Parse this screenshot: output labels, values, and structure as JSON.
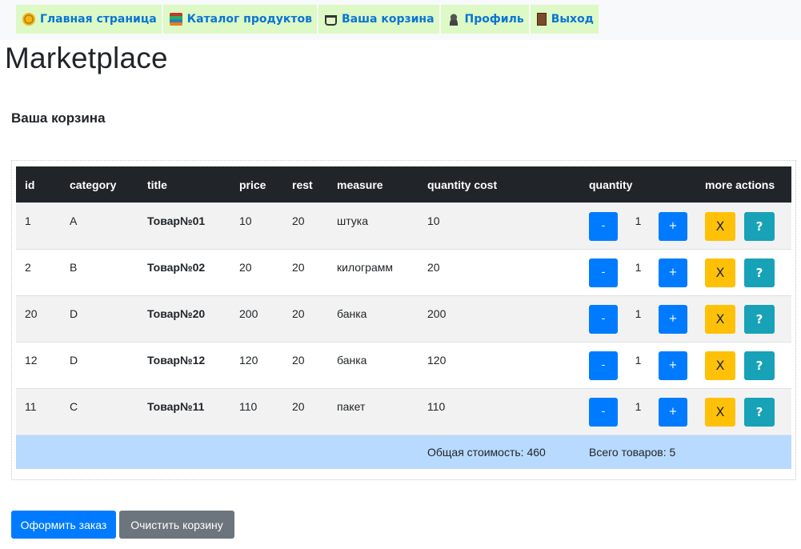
{
  "nav": {
    "items": [
      {
        "label": "Главная страница",
        "icon": "home-icon"
      },
      {
        "label": "Каталог продуктов",
        "icon": "books-icon"
      },
      {
        "label": "Ваша корзина",
        "icon": "cart-icon"
      },
      {
        "label": "Профиль",
        "icon": "user-icon"
      },
      {
        "label": "Выход",
        "icon": "door-icon"
      }
    ]
  },
  "site_title": "Marketplace",
  "cart_heading": "Ваша корзина",
  "table": {
    "headers": [
      "id",
      "category",
      "title",
      "price",
      "rest",
      "measure",
      "quantity cost",
      "quantity",
      "more actions"
    ],
    "rows": [
      {
        "id": "1",
        "category": "A",
        "title": "Товар№01",
        "price": "10",
        "rest": "20",
        "measure": "штука",
        "cost": "10",
        "qty": "1"
      },
      {
        "id": "2",
        "category": "B",
        "title": "Товар№02",
        "price": "20",
        "rest": "20",
        "measure": "килограмм",
        "cost": "20",
        "qty": "1"
      },
      {
        "id": "20",
        "category": "D",
        "title": "Товар№20",
        "price": "200",
        "rest": "20",
        "measure": "банка",
        "cost": "200",
        "qty": "1"
      },
      {
        "id": "12",
        "category": "D",
        "title": "Товар№12",
        "price": "120",
        "rest": "20",
        "measure": "банка",
        "cost": "120",
        "qty": "1"
      },
      {
        "id": "11",
        "category": "C",
        "title": "Товар№11",
        "price": "110",
        "rest": "20",
        "measure": "пакет",
        "cost": "110",
        "qty": "1"
      }
    ],
    "minus_label": "-",
    "plus_label": "+",
    "remove_label": "X",
    "info_label": "?",
    "total_cost": "Общая стоимость: 460",
    "total_items": "Всего товаров: 5"
  },
  "buttons": {
    "order": "Оформить заказ",
    "clear": "Очистить корзину"
  },
  "colors": {
    "nav_bg": "#ddf9c5",
    "nav_text": "#0a74d6",
    "header_bg": "#212529",
    "primary": "#007bff",
    "warning": "#ffc107",
    "info": "#17a2b8",
    "secondary": "#6c757d",
    "total_row": "#b8daff"
  }
}
